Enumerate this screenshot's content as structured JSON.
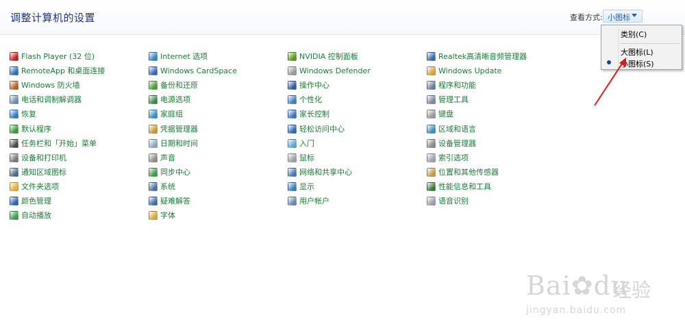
{
  "header": {
    "title": "调整计算机的设置",
    "view_by_label": "查看方式:",
    "view_by_value": "小图标"
  },
  "view_menu": {
    "items": [
      {
        "label": "类别(C)"
      },
      {
        "label": "大图标(L)"
      },
      {
        "label": "小图标(S)",
        "selected": true
      }
    ]
  },
  "columns": [
    {
      "items": [
        {
          "label": "Flash Player (32 位)",
          "color": "#c0241c"
        },
        {
          "label": "RemoteApp 和桌面连接",
          "color": "#2c6fb8"
        },
        {
          "label": "Windows 防火墙",
          "color": "#b8602a"
        },
        {
          "label": "电话和调制解调器",
          "color": "#6a8caf"
        },
        {
          "label": "恢复",
          "color": "#2f7ac9"
        },
        {
          "label": "默认程序",
          "color": "#3a9a3a"
        },
        {
          "label": "任务栏和「开始」菜单",
          "color": "#4a4a4a"
        },
        {
          "label": "设备和打印机",
          "color": "#777777"
        },
        {
          "label": "通知区域图标",
          "color": "#4b6a8a"
        },
        {
          "label": "文件夹选项",
          "color": "#e0b23a"
        },
        {
          "label": "颜色管理",
          "color": "#2e63b0"
        },
        {
          "label": "自动播放",
          "color": "#3c9c4e"
        }
      ]
    },
    {
      "items": [
        {
          "label": "Internet 选项",
          "color": "#2f86c9"
        },
        {
          "label": "Windows CardSpace",
          "color": "#3b66b5"
        },
        {
          "label": "备份和还原",
          "color": "#4f9a3a"
        },
        {
          "label": "电源选项",
          "color": "#3c8b4a"
        },
        {
          "label": "家庭组",
          "color": "#2d8fd0"
        },
        {
          "label": "凭据管理器",
          "color": "#c69a3a"
        },
        {
          "label": "日期和时间",
          "color": "#8aa8c8"
        },
        {
          "label": "声音",
          "color": "#8c8c8c"
        },
        {
          "label": "同步中心",
          "color": "#3aa048"
        },
        {
          "label": "系统",
          "color": "#4a6fa0"
        },
        {
          "label": "疑难解答",
          "color": "#3a6fb0"
        },
        {
          "label": "字体",
          "color": "#d4a93a"
        }
      ]
    },
    {
      "items": [
        {
          "label": "NVIDIA 控制面板",
          "color": "#5a9a1a"
        },
        {
          "label": "Windows Defender",
          "color": "#9a9a9a"
        },
        {
          "label": "操作中心",
          "color": "#2a5ca8"
        },
        {
          "label": "个性化",
          "color": "#3f7fc0"
        },
        {
          "label": "家长控制",
          "color": "#3a76c0"
        },
        {
          "label": "轻松访问中心",
          "color": "#2a6ab8"
        },
        {
          "label": "入门",
          "color": "#59a8d8"
        },
        {
          "label": "鼠标",
          "color": "#a0a0a0"
        },
        {
          "label": "网络和共享中心",
          "color": "#4a7ab0"
        },
        {
          "label": "显示",
          "color": "#3a7fb5"
        },
        {
          "label": "用户帐户",
          "color": "#6a8ab0"
        }
      ]
    },
    {
      "items": [
        {
          "label": "Realtek高清晰音频管理器",
          "color": "#3a6ab0"
        },
        {
          "label": "Windows Update",
          "color": "#d9a33a"
        },
        {
          "label": "程序和功能",
          "color": "#6a7fa0"
        },
        {
          "label": "管理工具",
          "color": "#7a8aa0"
        },
        {
          "label": "键盘",
          "color": "#9a9a9a"
        },
        {
          "label": "区域和语言",
          "color": "#3a8fc0"
        },
        {
          "label": "设备管理器",
          "color": "#8a8a8a"
        },
        {
          "label": "索引选项",
          "color": "#a0a0b0"
        },
        {
          "label": "位置和其他传感器",
          "color": "#c89a4a"
        },
        {
          "label": "性能信息和工具",
          "color": "#3a7a3a"
        },
        {
          "label": "语音识别",
          "color": "#9aa0aa"
        }
      ]
    }
  ],
  "watermark": {
    "text": "Bai",
    "text2": "du",
    "cn": "经验",
    "sub": "jingyan.baidu.com"
  }
}
